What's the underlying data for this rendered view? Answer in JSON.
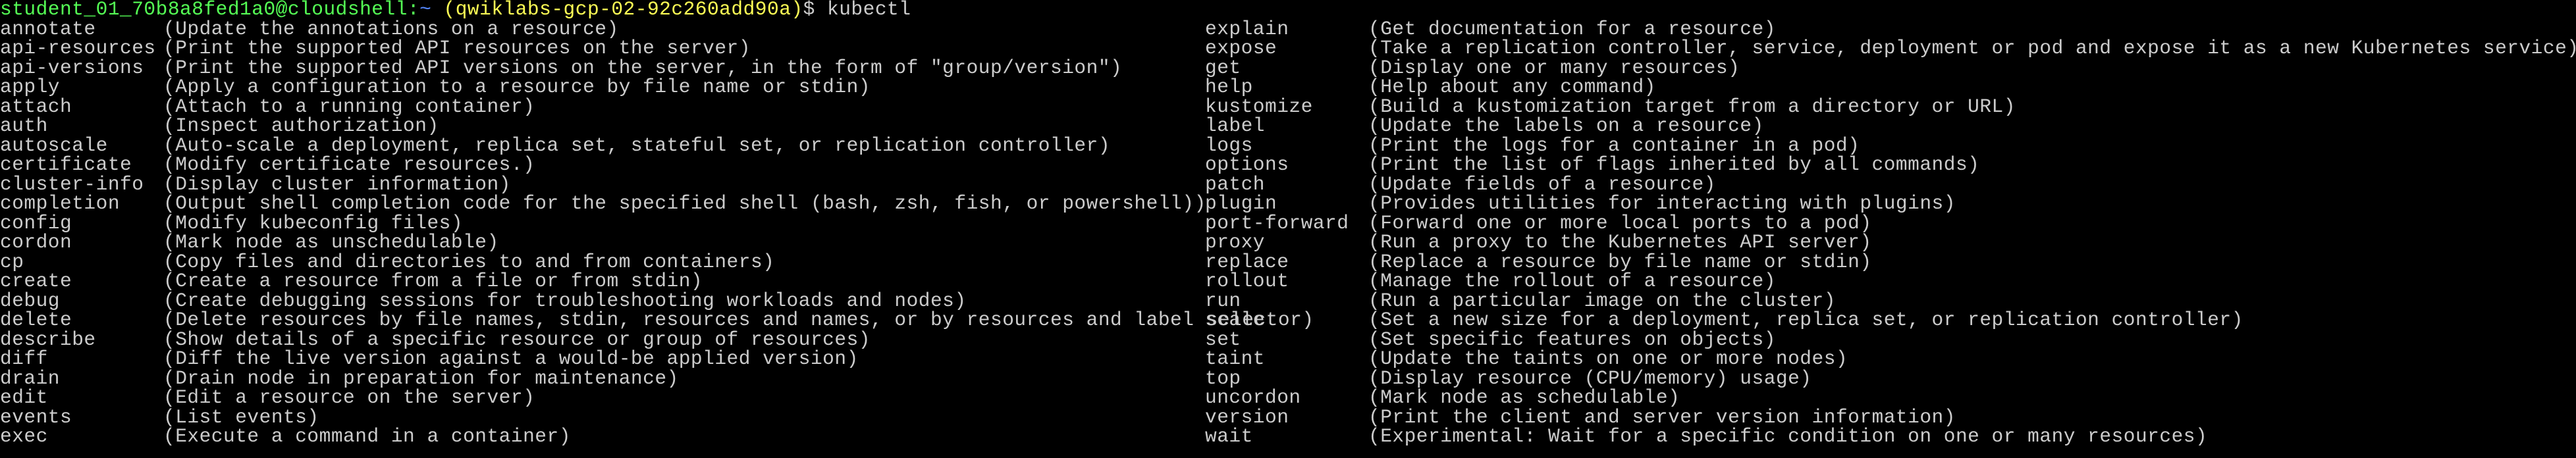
{
  "prompt": {
    "user": "student_01_70b8a8fed1a0@cloudshell",
    "separator": ":",
    "path": "~",
    "project_open": " (",
    "project": "qwiklabs-gcp-02-92c260add90a",
    "project_close": ")",
    "dollar": "$",
    "command": " kubectl"
  },
  "left_commands": [
    {
      "name": "annotate",
      "desc": "(Update the annotations on a resource)"
    },
    {
      "name": "api-resources",
      "desc": "(Print the supported API resources on the server)"
    },
    {
      "name": "api-versions",
      "desc": "(Print the supported API versions on the server, in the form of \"group/version\")"
    },
    {
      "name": "apply",
      "desc": "(Apply a configuration to a resource by file name or stdin)"
    },
    {
      "name": "attach",
      "desc": "(Attach to a running container)"
    },
    {
      "name": "auth",
      "desc": "(Inspect authorization)"
    },
    {
      "name": "autoscale",
      "desc": "(Auto-scale a deployment, replica set, stateful set, or replication controller)"
    },
    {
      "name": "certificate",
      "desc": "(Modify certificate resources.)"
    },
    {
      "name": "cluster-info",
      "desc": "(Display cluster information)"
    },
    {
      "name": "completion",
      "desc": "(Output shell completion code for the specified shell (bash, zsh, fish, or powershell))"
    },
    {
      "name": "config",
      "desc": "(Modify kubeconfig files)"
    },
    {
      "name": "cordon",
      "desc": "(Mark node as unschedulable)"
    },
    {
      "name": "cp",
      "desc": "(Copy files and directories to and from containers)"
    },
    {
      "name": "create",
      "desc": "(Create a resource from a file or from stdin)"
    },
    {
      "name": "debug",
      "desc": "(Create debugging sessions for troubleshooting workloads and nodes)"
    },
    {
      "name": "delete",
      "desc": "(Delete resources by file names, stdin, resources and names, or by resources and label selector)"
    },
    {
      "name": "describe",
      "desc": "(Show details of a specific resource or group of resources)"
    },
    {
      "name": "diff",
      "desc": "(Diff the live version against a would-be applied version)"
    },
    {
      "name": "drain",
      "desc": "(Drain node in preparation for maintenance)"
    },
    {
      "name": "edit",
      "desc": "(Edit a resource on the server)"
    },
    {
      "name": "events",
      "desc": "(List events)"
    },
    {
      "name": "exec",
      "desc": "(Execute a command in a container)"
    }
  ],
  "right_commands": [
    {
      "name": "explain",
      "desc": "(Get documentation for a resource)"
    },
    {
      "name": "expose",
      "desc": "(Take a replication controller, service, deployment or pod and expose it as a new Kubernetes service)"
    },
    {
      "name": "get",
      "desc": "(Display one or many resources)"
    },
    {
      "name": "help",
      "desc": "(Help about any command)"
    },
    {
      "name": "kustomize",
      "desc": "(Build a kustomization target from a directory or URL)"
    },
    {
      "name": "label",
      "desc": "(Update the labels on a resource)"
    },
    {
      "name": "logs",
      "desc": "(Print the logs for a container in a pod)"
    },
    {
      "name": "options",
      "desc": "(Print the list of flags inherited by all commands)"
    },
    {
      "name": "patch",
      "desc": "(Update fields of a resource)"
    },
    {
      "name": "plugin",
      "desc": "(Provides utilities for interacting with plugins)"
    },
    {
      "name": "port-forward",
      "desc": "(Forward one or more local ports to a pod)"
    },
    {
      "name": "proxy",
      "desc": "(Run a proxy to the Kubernetes API server)"
    },
    {
      "name": "replace",
      "desc": "(Replace a resource by file name or stdin)"
    },
    {
      "name": "rollout",
      "desc": "(Manage the rollout of a resource)"
    },
    {
      "name": "run",
      "desc": "(Run a particular image on the cluster)"
    },
    {
      "name": "scale",
      "desc": "(Set a new size for a deployment, replica set, or replication controller)"
    },
    {
      "name": "set",
      "desc": "(Set specific features on objects)"
    },
    {
      "name": "taint",
      "desc": "(Update the taints on one or more nodes)"
    },
    {
      "name": "top",
      "desc": "(Display resource (CPU/memory) usage)"
    },
    {
      "name": "uncordon",
      "desc": "(Mark node as schedulable)"
    },
    {
      "name": "version",
      "desc": "(Print the client and server version information)"
    },
    {
      "name": "wait",
      "desc": "(Experimental: Wait for a specific condition on one or many resources)"
    }
  ]
}
